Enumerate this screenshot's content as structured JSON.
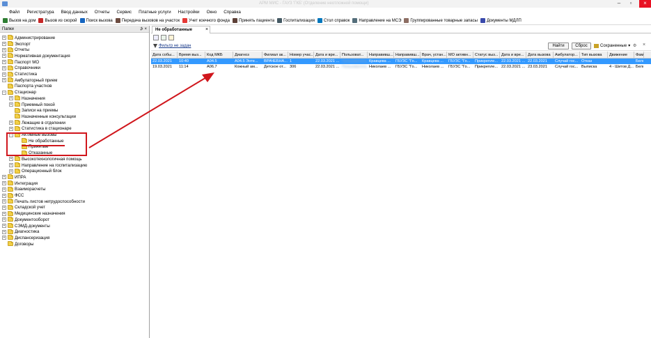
{
  "titlebar": {
    "title": "АРМ МИС - ГАУЗ 'ГКБ' (Отделение неотложной помощи)"
  },
  "menu": [
    "Файл",
    "Регистратура",
    "Ввод данных",
    "Отчеты",
    "Сервис",
    "Платные услуги",
    "Настройки",
    "Окно",
    "Справка"
  ],
  "toolbar": [
    {
      "label": "Вызов на дом",
      "icon": "house-icon",
      "color": "#2e7d32"
    },
    {
      "label": "Вызов из скорой",
      "icon": "ambulance-icon",
      "color": "#c62828"
    },
    {
      "label": "Поиск вызова",
      "icon": "search-icon",
      "color": "#1565c0"
    },
    {
      "label": "Передача вызовов на участок",
      "icon": "transfer-icon",
      "color": "#6d4c41"
    },
    {
      "label": "Учет коечного фонда",
      "icon": "bed-icon",
      "color": "#e53935"
    },
    {
      "label": "Принять пациента",
      "icon": "patient-icon",
      "color": "#5d4037"
    },
    {
      "label": "Госпитализация",
      "icon": "hospital-icon",
      "color": "#455a64"
    },
    {
      "label": "Стол справок",
      "icon": "info-desk-icon",
      "color": "#0277bd"
    },
    {
      "label": "Направление на МСЭ",
      "icon": "referral-icon",
      "color": "#546e7a"
    },
    {
      "label": "Группированные товарные запасы",
      "icon": "stock-icon",
      "color": "#8d6e63"
    },
    {
      "label": "Документы МДЛП",
      "icon": "documents-icon",
      "color": "#3949ab"
    }
  ],
  "left_panel": {
    "header": "Папки",
    "pin": "⊅",
    "close": "×"
  },
  "tree": [
    {
      "label": "Администрирование",
      "exp": "+",
      "level": 0
    },
    {
      "label": "Экспорт",
      "exp": "+",
      "level": 0
    },
    {
      "label": "Отчеты",
      "exp": "+",
      "level": 0
    },
    {
      "label": "Нормативная документация",
      "exp": "+",
      "level": 0
    },
    {
      "label": "Паспорт МО",
      "exp": "+",
      "level": 0
    },
    {
      "label": "Справочники",
      "exp": "+",
      "level": 0
    },
    {
      "label": "Статистика",
      "exp": "+",
      "level": 0
    },
    {
      "label": "Амбулаторный прием",
      "exp": "+",
      "level": 0
    },
    {
      "label": "Паспорта участков",
      "exp": "",
      "level": 0
    },
    {
      "label": "Стационар",
      "exp": "−",
      "level": 0
    },
    {
      "label": "Назначения",
      "exp": "+",
      "level": 1
    },
    {
      "label": "Приемный покой",
      "exp": "+",
      "level": 1
    },
    {
      "label": "Записи на приемы",
      "exp": "",
      "level": 1
    },
    {
      "label": "Назначенные консультации",
      "exp": "",
      "level": 1
    },
    {
      "label": "Лежащие в отделении",
      "exp": "+",
      "level": 1
    },
    {
      "label": "Статистика в стационаре",
      "exp": "+",
      "level": 1
    },
    {
      "label": "Активные вызовы",
      "exp": "−",
      "level": 1
    },
    {
      "label": "Не обработанные",
      "exp": "",
      "level": 2
    },
    {
      "label": "Принятые",
      "exp": "",
      "level": 2
    },
    {
      "label": "Отказанные",
      "exp": "",
      "level": 2
    },
    {
      "label": "Высокотехнологичная помощь",
      "exp": "+",
      "level": 1
    },
    {
      "label": "Направление на госпитализацию",
      "exp": "+",
      "level": 1
    },
    {
      "label": "Операционный блок",
      "exp": "+",
      "level": 1
    },
    {
      "label": "ИПРА",
      "exp": "+",
      "level": 0
    },
    {
      "label": "Интеграция",
      "exp": "+",
      "level": 0
    },
    {
      "label": "Взаиморасчеты",
      "exp": "+",
      "level": 0
    },
    {
      "label": "ФСС",
      "exp": "+",
      "level": 0
    },
    {
      "label": "Печать листов нетрудоспособности",
      "exp": "+",
      "level": 0
    },
    {
      "label": "Складской учет",
      "exp": "+",
      "level": 0
    },
    {
      "label": "Медицинские назначения",
      "exp": "+",
      "level": 0
    },
    {
      "label": "Документооборот",
      "exp": "+",
      "level": 0
    },
    {
      "label": "СЭМД-документы",
      "exp": "+",
      "level": 0
    },
    {
      "label": "Диагностика",
      "exp": "+",
      "level": 0
    },
    {
      "label": "Диспансеризация",
      "exp": "+",
      "level": 0
    },
    {
      "label": "Договоры",
      "exp": "",
      "level": 0
    }
  ],
  "tab": {
    "label": "Не обработанные",
    "close": "×"
  },
  "filter": {
    "label": "Фильтр не задан",
    "find": "Найти",
    "reset": "Сброс",
    "saved": "Сохраненные"
  },
  "columns": [
    "Дата собы...",
    "Время выз...",
    "Код МКБ",
    "Диагноз",
    "Филиал ак...",
    "Номер учас...",
    "Дата и вре...",
    "Пользоват...",
    "Направивш...",
    "Направивш...",
    "Врач, устан...",
    "МО активн...",
    "Статус выз...",
    "Дата и вре...",
    "Дата вызова",
    "Амбулатор...",
    "Тип вызова",
    "Движение",
    "Фам"
  ],
  "rows": [
    {
      "selected": true,
      "cells": [
        "22.03.2021",
        "10:40",
        "A04.5",
        "A04.5 Энте...",
        "ВРАЧЕБНА...",
        "1",
        "22.03.2021 ...",
        "Пользователь",
        "Кравцева ...",
        "ГБУЗС \"Го...",
        "Кравцева ...",
        "ГБУЗС \"Го...",
        "Прикрепле...",
        "22.03.2021 ...",
        "22.03.2021",
        "Случай гос...",
        "Отказ",
        "",
        "Бело"
      ]
    },
    {
      "selected": false,
      "cells": [
        "19.03.2021",
        "11:14",
        "A06.7",
        "Кожный ам...",
        "Детское от...",
        "306",
        "22.03.2021 ...",
        "Пользователь",
        "Николаев ...",
        "ГБУЗС \"Го...",
        "Николаев ...",
        "ГБУЗС \"Го...",
        "Прикрепле...",
        "22.03.2021 ...",
        "23.03.2021",
        "Случай гос...",
        "Выписка",
        "4 - Шитов Д...",
        "Бело"
      ]
    }
  ]
}
